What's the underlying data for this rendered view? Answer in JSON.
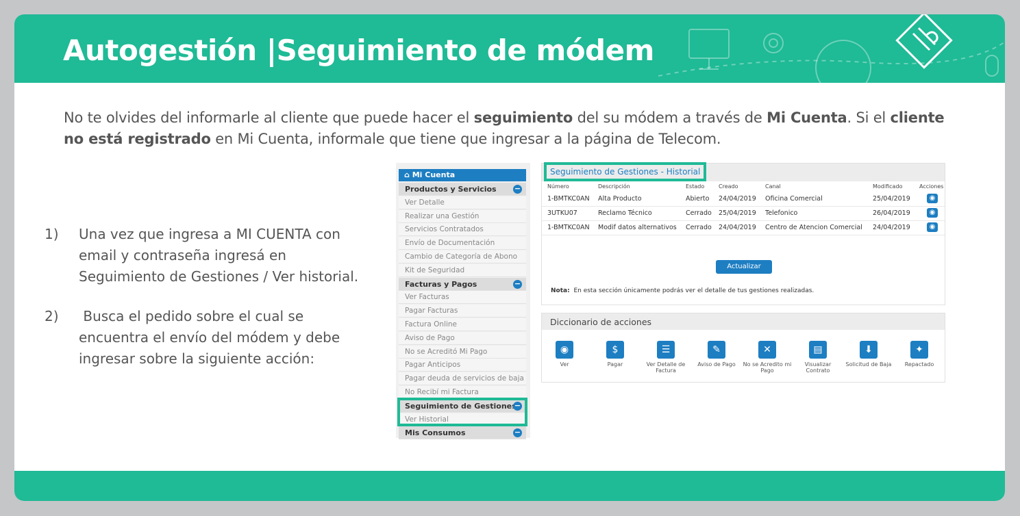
{
  "title": "Autogestión |Seguimiento de módem",
  "intro": {
    "p1": "No te olvides del informarle al cliente que puede hacer el ",
    "b1": "seguimiento",
    "p2": " del su módem a través de ",
    "b2": "Mi Cuenta",
    "p3": ". Si el ",
    "b3": "cliente no está registrado",
    "p4": " en Mi Cuenta, informale que tiene que ingresar a la página de Telecom."
  },
  "steps": [
    {
      "num": "1)",
      "text": "Una vez que ingresa a MI CUENTA con email y contraseña ingresá en Seguimiento de Gestiones / Ver historial."
    },
    {
      "num": "2)",
      "text": " Busca el pedido sobre el cual se encuentra el envío del módem y debe ingresar sobre la siguiente acción:"
    }
  ],
  "sidebar": {
    "home": "Mi Cuenta",
    "rows": [
      {
        "label": "Productos y Servicios",
        "header": true
      },
      {
        "label": "Ver Detalle"
      },
      {
        "label": "Realizar una Gestión"
      },
      {
        "label": "Servicios Contratados"
      },
      {
        "label": "Envío de Documentación"
      },
      {
        "label": "Cambio de Categoría de Abono"
      },
      {
        "label": "Kit de Seguridad"
      },
      {
        "label": "Facturas y Pagos",
        "header": true
      },
      {
        "label": "Ver Facturas"
      },
      {
        "label": "Pagar Facturas"
      },
      {
        "label": "Factura Online"
      },
      {
        "label": "Aviso de Pago"
      },
      {
        "label": "No se Acreditó Mi Pago"
      },
      {
        "label": "Pagar Anticipos"
      },
      {
        "label": "Pagar deuda de servicios de baja"
      },
      {
        "label": "No Recibí mi Factura"
      },
      {
        "label": "Seguimiento de Gestiones",
        "header": true
      },
      {
        "label": "Ver Historial"
      },
      {
        "label": "Mis Consumos",
        "header": true
      }
    ]
  },
  "historial": {
    "title": "Seguimiento de Gestiones - Historial",
    "columns": [
      "Número",
      "Descripción",
      "Estado",
      "Creado",
      "Canal",
      "Modificado",
      "Acciones"
    ],
    "rows": [
      [
        "1-BMTKC0AN",
        "Alta Producto",
        "Abierto",
        "24/04/2019",
        "Oficina Comercial",
        "25/04/2019"
      ],
      [
        "3UTKU07",
        "Reclamo Técnico",
        "Cerrado",
        "25/04/2019",
        "Telefonico",
        "26/04/2019"
      ],
      [
        "1-BMTKC0AN",
        "Modif datos alternativos",
        "Cerrado",
        "24/04/2019",
        "Centro de Atencion Comercial",
        "24/04/2019"
      ]
    ],
    "button": "Actualizar",
    "nota_label": "Nota:",
    "nota_text": "En esta sección únicamente podrás ver el detalle de tus gestiones realizadas."
  },
  "diccionario": {
    "title": "Diccionario de acciones",
    "actions": [
      {
        "icon": "eye-icon",
        "label": "Ver"
      },
      {
        "icon": "pay-icon",
        "label": "Pagar"
      },
      {
        "icon": "invoice-detail-icon",
        "label": "Ver Detalle de Factura"
      },
      {
        "icon": "payment-notice-icon",
        "label": "Aviso de Pago"
      },
      {
        "icon": "payment-not-credited-icon",
        "label": "No se Acredito mi Pago"
      },
      {
        "icon": "contract-icon",
        "label": "Visualizar Contrato"
      },
      {
        "icon": "download-arrow-icon",
        "label": "Solicitud de Baja"
      },
      {
        "icon": "wrench-icon",
        "label": "Repactado"
      }
    ]
  },
  "colors": {
    "brand": "#1fba96",
    "link": "#1d7ec2"
  }
}
